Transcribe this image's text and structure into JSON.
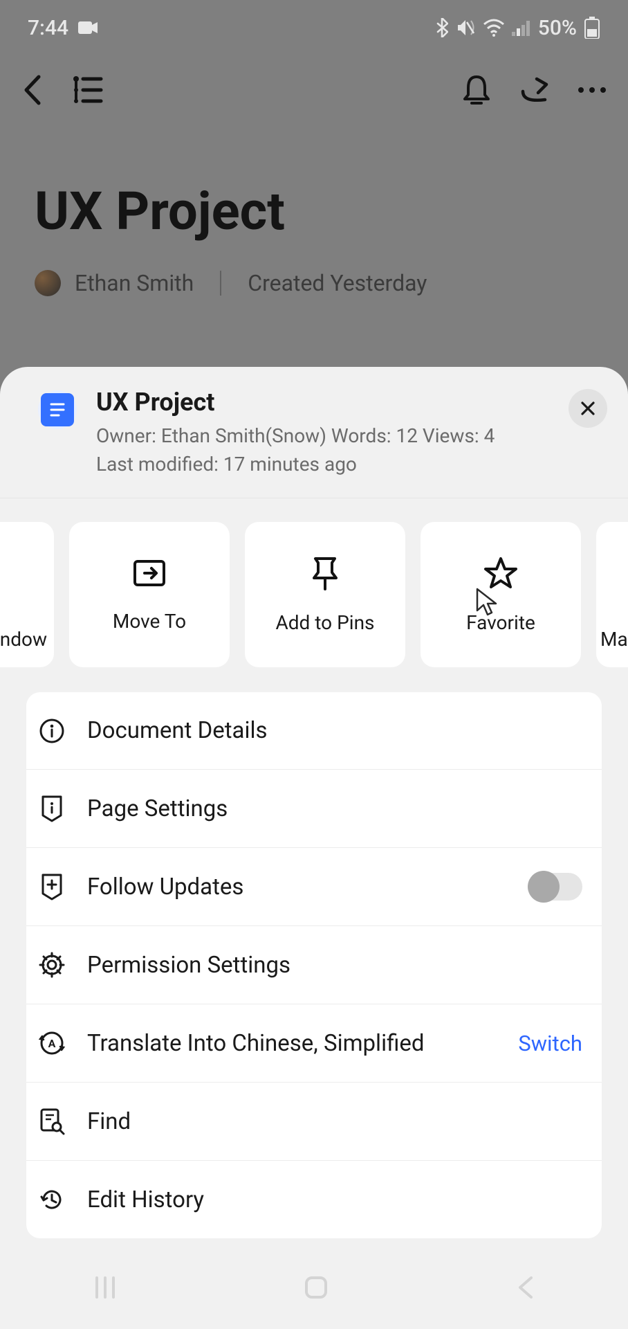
{
  "status": {
    "time": "7:44",
    "battery_text": "50%"
  },
  "background": {
    "title": "UX Project",
    "author": "Ethan Smith",
    "created": "Created Yesterday"
  },
  "sheet": {
    "title": "UX Project",
    "owner_line": "Owner: Ethan Smith(Snow)  Words: 12  Views: 4",
    "modified_line": "Last modified: 17 minutes ago"
  },
  "quick": {
    "partial_left": "ndow",
    "move_to": "Move To",
    "add_to_pins": "Add to Pins",
    "favorite": "Favorite",
    "partial_right": "Ma"
  },
  "options": {
    "document_details": "Document Details",
    "page_settings": "Page Settings",
    "follow_updates": "Follow Updates",
    "permission_settings": "Permission Settings",
    "translate": "Translate Into Chinese, Simplified",
    "switch": "Switch",
    "find": "Find",
    "edit_history": "Edit History"
  }
}
